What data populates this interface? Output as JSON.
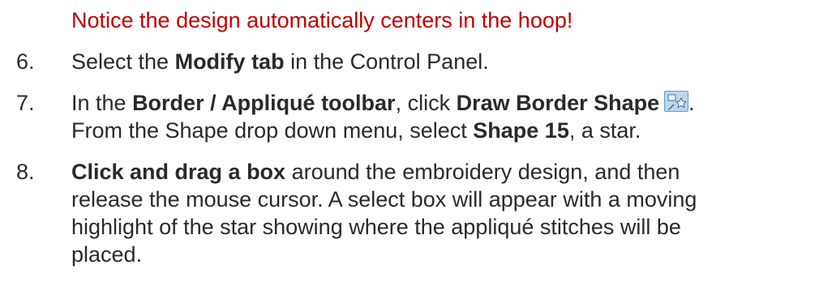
{
  "note": "Notice the design automatically centers in the hoop!",
  "steps": [
    {
      "number": "6.",
      "lines": [
        {
          "t1": "Select the ",
          "b1": "Modify tab",
          "t2": " in the Control Panel."
        }
      ]
    },
    {
      "number": "7.",
      "lines": [
        {
          "t1": "In the ",
          "b1": "Border / Appliqué toolbar",
          "t2": ", click ",
          "b2": "Draw Border Shape",
          "t3": ".",
          "icon": "draw-border-shape-icon"
        },
        {
          "t1": "From the Shape drop down menu, select ",
          "b1": "Shape 15",
          "t2": ", a star."
        }
      ]
    },
    {
      "number": "8.",
      "lines": [
        {
          "b1": "Click and drag a box",
          "t1": " around the embroidery design, and then"
        },
        {
          "t1": "release the mouse cursor.  A select box will appear with a moving"
        },
        {
          "t1": "highlight of the star showing where the appliqué stitches will be"
        },
        {
          "t1": "placed."
        }
      ]
    }
  ],
  "colors": {
    "note": "#c00000",
    "text": "#2a2a2a",
    "icon_bg": "#bcd6ee",
    "icon_border": "#6a9ac6"
  }
}
